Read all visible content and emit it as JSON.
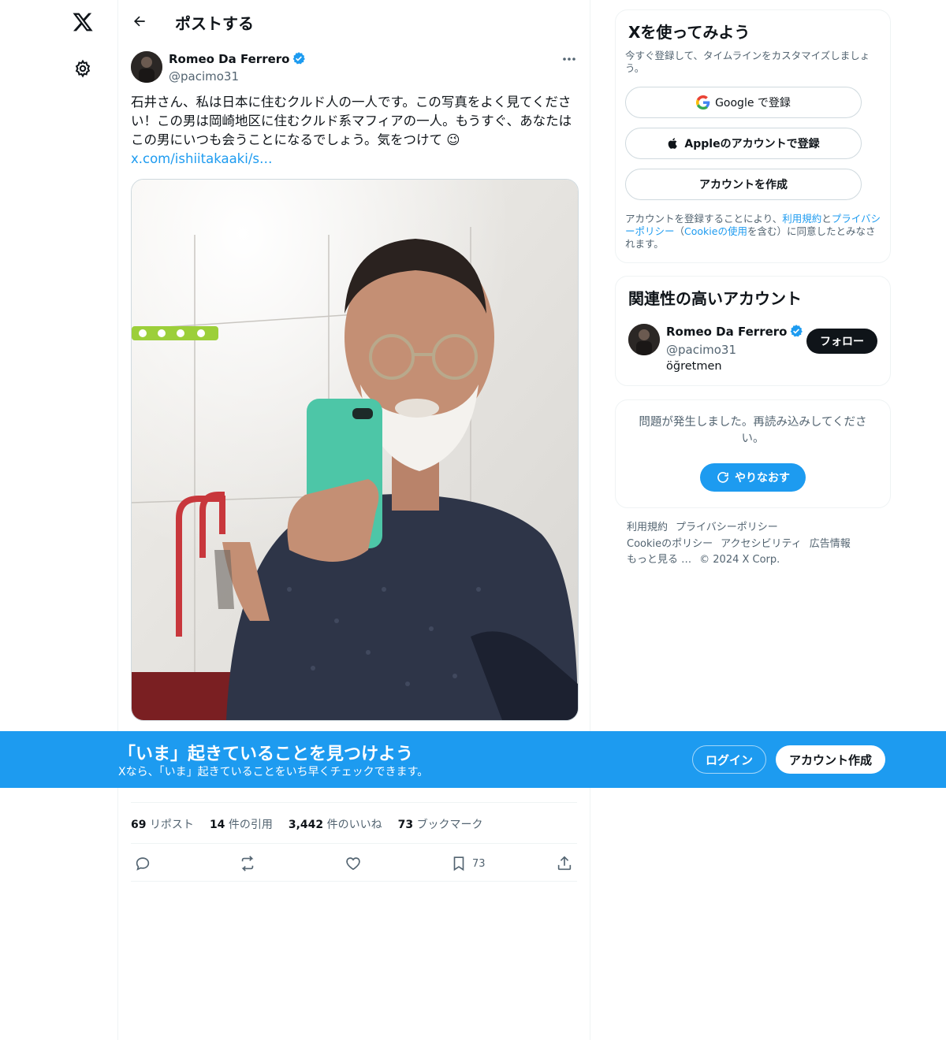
{
  "nav": {
    "logo": "x-logo",
    "settings": "gear-icon"
  },
  "header": {
    "title": "ポストする"
  },
  "post": {
    "author_name": "Romeo Da Ferrero",
    "author_handle": "@pacimo31",
    "text": "石井さん、私は日本に住むクルド人の一人です。この写真をよく見てください！この男は岡崎地区に住むクルド系マフィアの一人。もうすぐ、あなたはこの男にいつも会うことになるでしょう。気をつけて 😉",
    "link": "x.com/ishiitakaaki/s…",
    "stats": [
      {
        "num": "69",
        "label": "リポスト"
      },
      {
        "num": "14",
        "label": "件の引用"
      },
      {
        "num": "3,442",
        "label": "件のいいね"
      },
      {
        "num": "73",
        "label": "ブックマーク"
      }
    ],
    "bookmark_count": "73"
  },
  "signup": {
    "title": "Xを使ってみよう",
    "subtitle": "今すぐ登録して、タイムラインをカスタマイズしましょう。",
    "google": "Google で登録",
    "apple": "Appleのアカウントで登録",
    "create": "アカウントを作成",
    "legal_1": "アカウントを登録することにより、",
    "legal_terms": "利用規約",
    "legal_2": "と",
    "legal_privacy": "プライバシーポリシー",
    "legal_3": "（",
    "legal_cookie": "Cookieの使用",
    "legal_4": "を含む）に同意したとみなされます。"
  },
  "relevant": {
    "title": "関連性の高いアカウント",
    "name": "Romeo Da Ferrero",
    "handle": "@pacimo31",
    "bio": "öğretmen",
    "follow": "フォロー"
  },
  "error": {
    "message": "問題が発生しました。再読み込みしてください。",
    "retry": "やりなおす"
  },
  "footer": {
    "links": [
      "利用規約",
      "プライバシーポリシー",
      "Cookieのポリシー",
      "アクセシビリティ",
      "広告情報",
      "もっと見る …"
    ],
    "copyright": "© 2024 X Corp."
  },
  "banner": {
    "headline": "「いま」起きていることを見つけよう",
    "sub": "Xなら、「いま」起きていることをいち早くチェックできます。",
    "login": "ログイン",
    "signup": "アカウント作成"
  },
  "colors": {
    "accent": "#1d9bf0",
    "text": "#0f1419",
    "muted": "#536471"
  }
}
